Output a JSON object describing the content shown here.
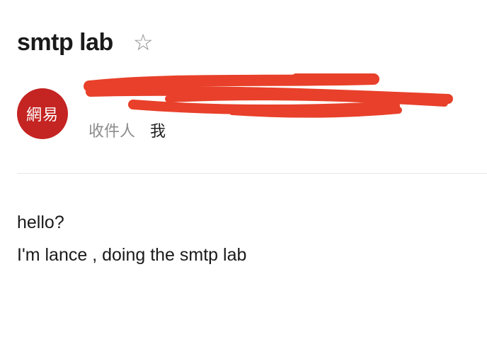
{
  "email": {
    "subject": "smtp lab",
    "star_icon": "☆",
    "avatar_text": "網易",
    "sender": "",
    "recipient_label": "收件人",
    "recipient_value": "我",
    "body_lines": [
      "hello?",
      "I'm lance , doing the smtp lab"
    ]
  },
  "colors": {
    "avatar_bg": "#c42422",
    "redaction": "#e8402a"
  }
}
